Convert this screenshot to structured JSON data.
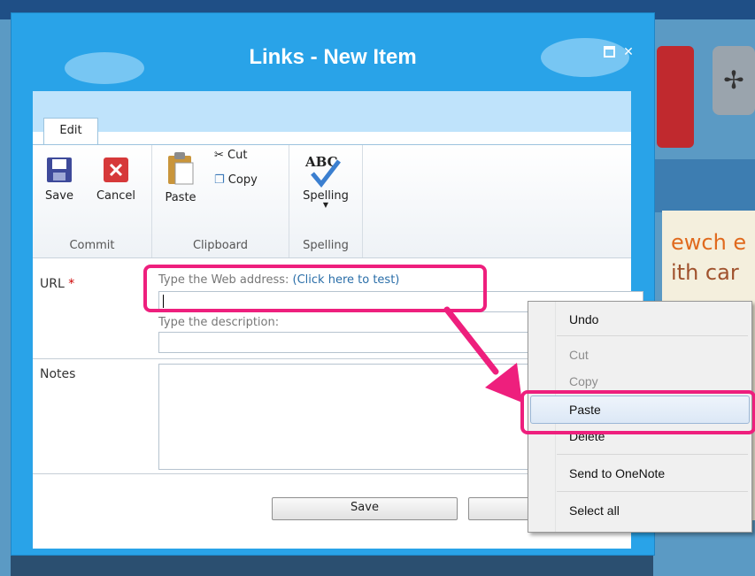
{
  "dialog": {
    "title": "Links - New Item"
  },
  "ribbon": {
    "tab": "Edit",
    "groups": {
      "commit": {
        "label": "Commit",
        "save": "Save",
        "cancel": "Cancel"
      },
      "clipboard": {
        "label": "Clipboard",
        "paste": "Paste",
        "cut": "Cut",
        "copy": "Copy"
      },
      "spelling": {
        "label": "Spelling",
        "spelling": "Spelling",
        "icon_text": "ABC"
      }
    }
  },
  "form": {
    "url_label": "URL",
    "required_marker": "*",
    "url_hint": "Type the Web address: ",
    "url_link": "(Click here to test)",
    "desc_hint": "Type the description:",
    "notes_label": "Notes",
    "save_button": "Save"
  },
  "context_menu": {
    "items": [
      "Undo",
      "Cut",
      "Copy",
      "Paste",
      "Delete",
      "Send to OneNote",
      "Select all"
    ]
  },
  "background": {
    "text_line1": "ewch e",
    "text_line2": "ith car"
  },
  "colors": {
    "dialog_blue": "#29a3e8",
    "highlight_pink": "#ee1f7d"
  }
}
